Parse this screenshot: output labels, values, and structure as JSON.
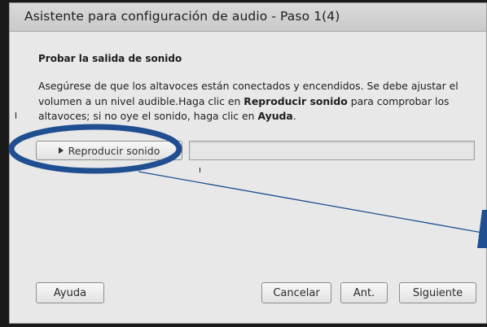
{
  "dialog": {
    "title": "Asistente para configuración de audio - Paso 1(4)",
    "heading": "Probar la salida de sonido",
    "description": {
      "part1": "Asegúrese de que los altavoces están conectados y encendidos. Se debe ajustar el volumen a un nivel audible.Haga clic en ",
      "bold1": "Reproducir sonido",
      "part2": " para comprobar los altavoces; si no oye el sonido, haga clic en ",
      "bold2": "Ayuda",
      "part3": "."
    },
    "play_button_label": "Reproducir sonido",
    "sound_level": 0.0
  },
  "footer": {
    "help_label": "Ayuda",
    "cancel_label": "Cancelar",
    "back_label": "Ant.",
    "next_label": "Siguiente"
  },
  "annotation": {
    "color": "#1f4e91"
  }
}
